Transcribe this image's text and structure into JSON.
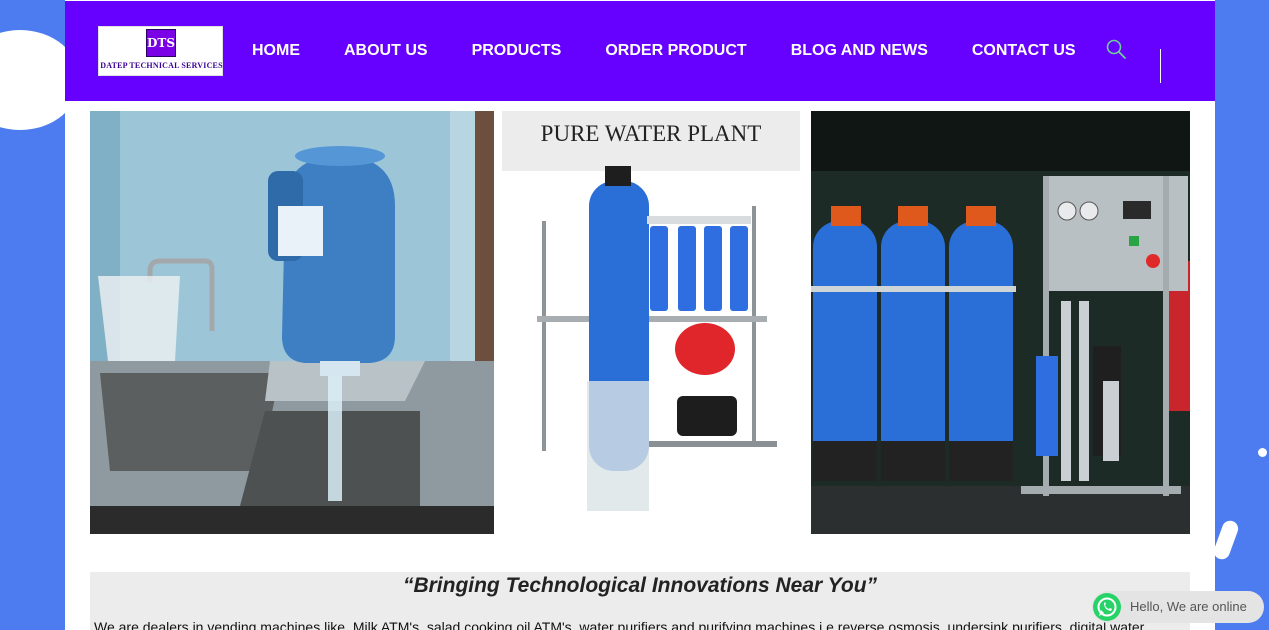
{
  "brand": {
    "logo_mark": "DTS",
    "logo_text": "DATEP TECHNICAL SERVICES"
  },
  "nav": {
    "items": [
      {
        "label": "HOME"
      },
      {
        "label": "ABOUT US"
      },
      {
        "label": "PRODUCTS"
      },
      {
        "label": "ORDER PRODUCT"
      },
      {
        "label": "BLOG AND NEWS"
      },
      {
        "label": "CONTACT US"
      }
    ]
  },
  "gallery": {
    "plant_caption": "PURE WATER PLANT"
  },
  "content": {
    "tagline": "“Bringing Technological Innovations Near You”",
    "intro": "We are dealers in vending machines like, Milk ATM's, salad cooking oil ATM's, water purifiers and purifying machines i.e reverse osmosis, undersink purifiers, digital water"
  },
  "chat": {
    "label": "Hello, We are online"
  },
  "colors": {
    "header": "#6600ff",
    "background": "#4c7cf0",
    "whatsapp": "#25d366",
    "tank_blue": "#2a6fd8"
  }
}
